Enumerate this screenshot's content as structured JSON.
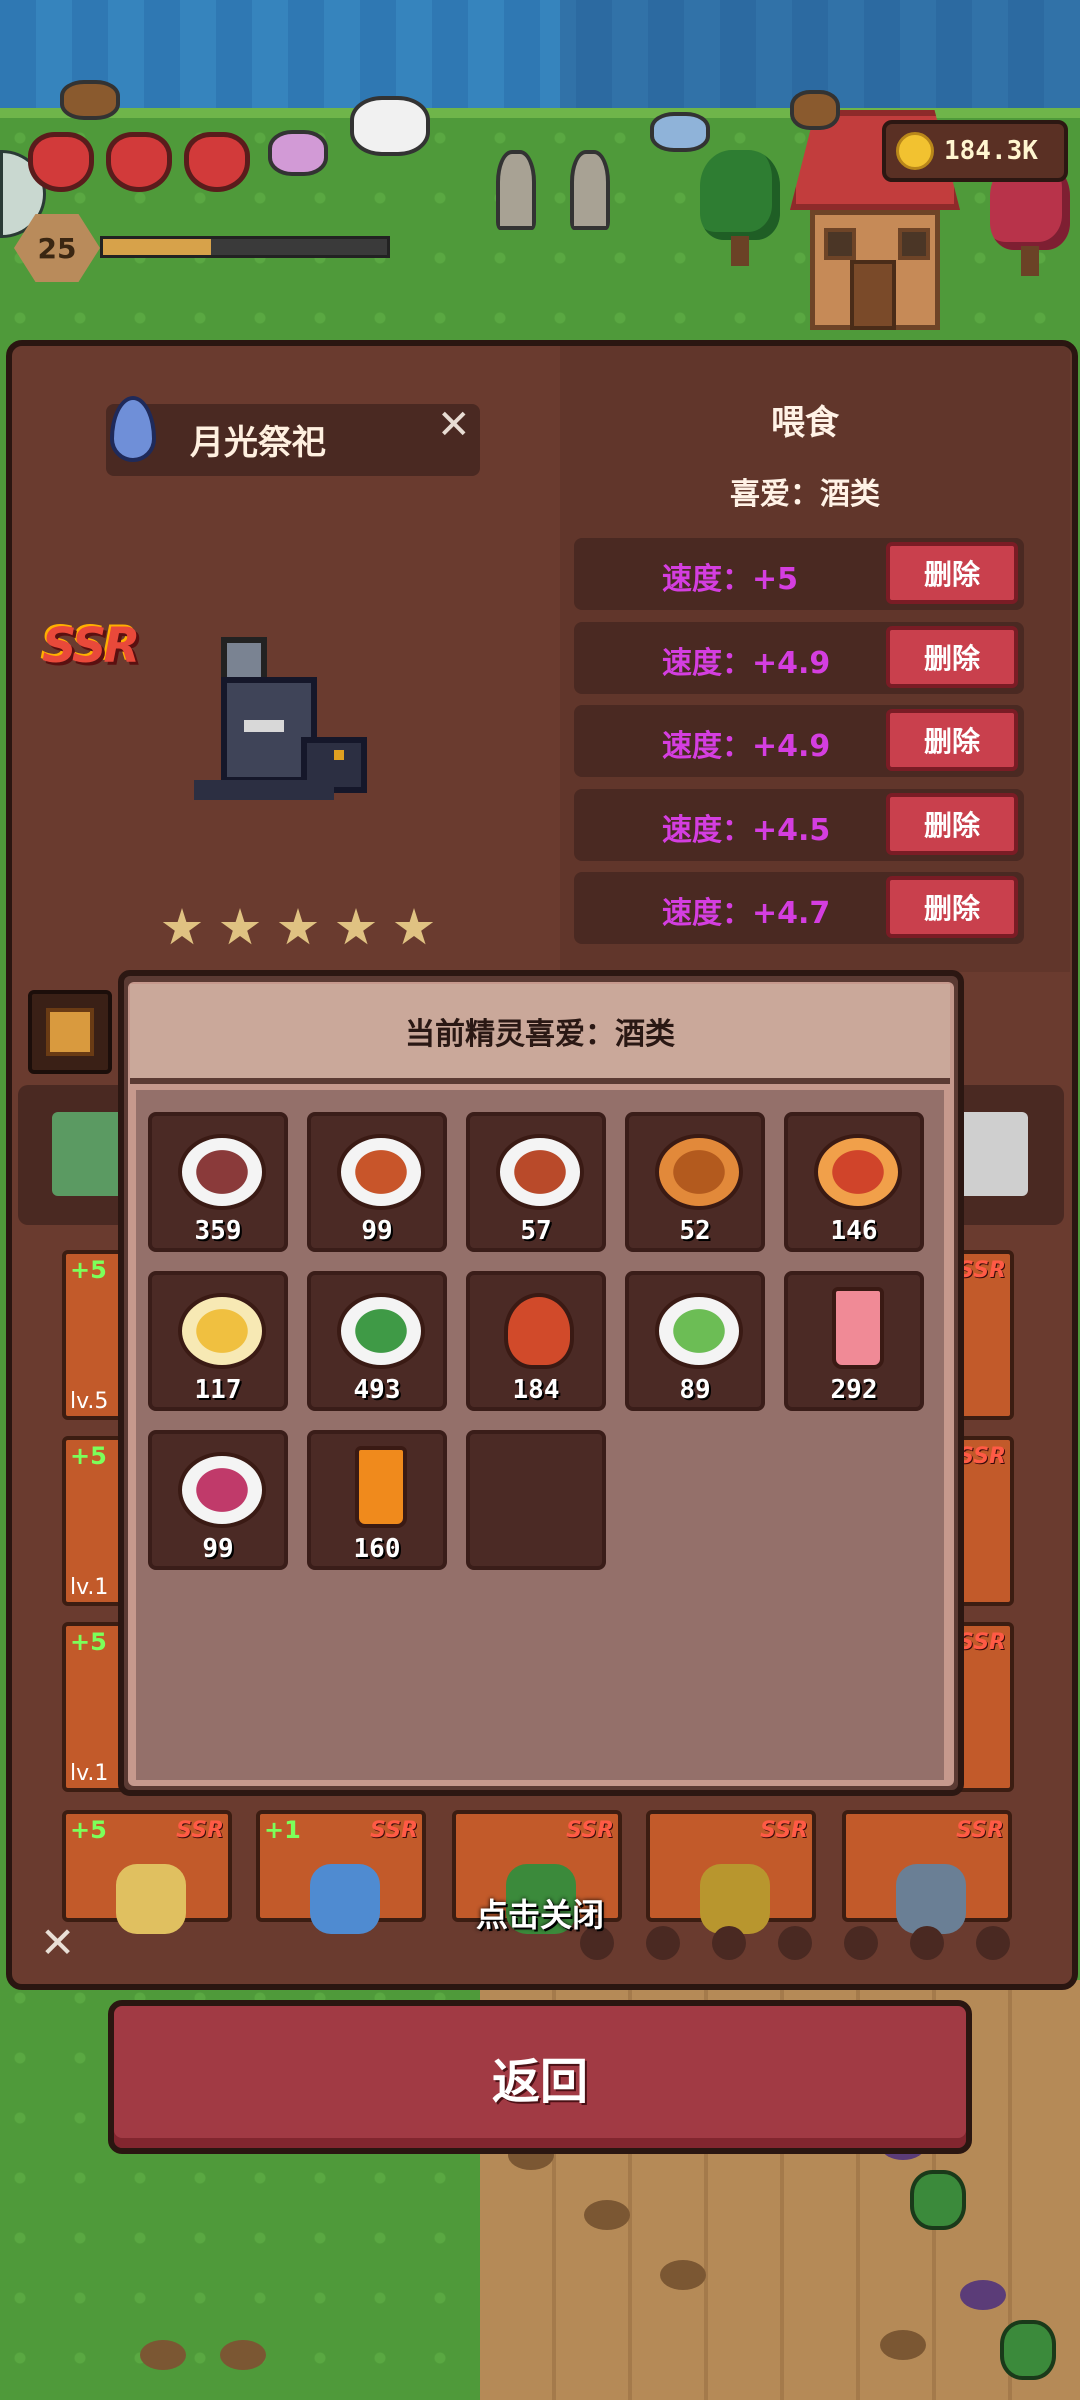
{
  "hud": {
    "level": "25",
    "xp_progress": 0.38,
    "hearts": 3,
    "coins": "184.3K"
  },
  "spirit": {
    "name": "月光祭祀",
    "rarity": "SSR",
    "stars": 5,
    "element_icon": "water-drop-icon"
  },
  "feed": {
    "title": "喂食",
    "favorite": "喜爱：酒类",
    "delete_label": "删除",
    "stats": [
      {
        "label": "速度：+5"
      },
      {
        "label": "速度：+4.9"
      },
      {
        "label": "速度：+4.9"
      },
      {
        "label": "速度：+4.5"
      },
      {
        "label": "速度：+4.7"
      }
    ]
  },
  "modal": {
    "header": "当前精灵喜爱：酒类",
    "items": [
      {
        "icon": "steak-icon",
        "count": "359"
      },
      {
        "icon": "ribs-icon",
        "count": "99"
      },
      {
        "icon": "stew-icon",
        "count": "57"
      },
      {
        "icon": "pancake-icon",
        "count": "52"
      },
      {
        "icon": "pizza-icon",
        "count": "146"
      },
      {
        "icon": "omelette-icon",
        "count": "117"
      },
      {
        "icon": "salad-icon",
        "count": "493"
      },
      {
        "icon": "drumstick-icon",
        "count": "184"
      },
      {
        "icon": "green-dish-icon",
        "count": "89"
      },
      {
        "icon": "pink-drink-icon",
        "count": "292"
      },
      {
        "icon": "fruit-bowl-icon",
        "count": "99"
      },
      {
        "icon": "orange-juice-icon",
        "count": "160"
      },
      {
        "icon": "empty-slot",
        "count": ""
      }
    ]
  },
  "cards": [
    {
      "plus": "+5",
      "lv": "lv.5"
    },
    {
      "plus": "+5",
      "lv": "lv.1"
    },
    {
      "plus": "+5",
      "lv": "lv.1"
    },
    {
      "plus": "+5",
      "ssr": "SSR"
    },
    {
      "plus": "+1",
      "ssr": "SSR"
    },
    {
      "ssr": "SSR"
    },
    {
      "ssr": "SSR"
    },
    {
      "ssr": "SSR"
    }
  ],
  "card_ssr_right": [
    "SSR",
    "SSR",
    "SSR"
  ],
  "tap_to_close": "点击关闭",
  "return_label": "返回",
  "colors": {
    "panel": "#6a3b2f",
    "delete_button": "#c9404d",
    "stat_text": "#d43ee0",
    "return_button": "#a13a44"
  }
}
